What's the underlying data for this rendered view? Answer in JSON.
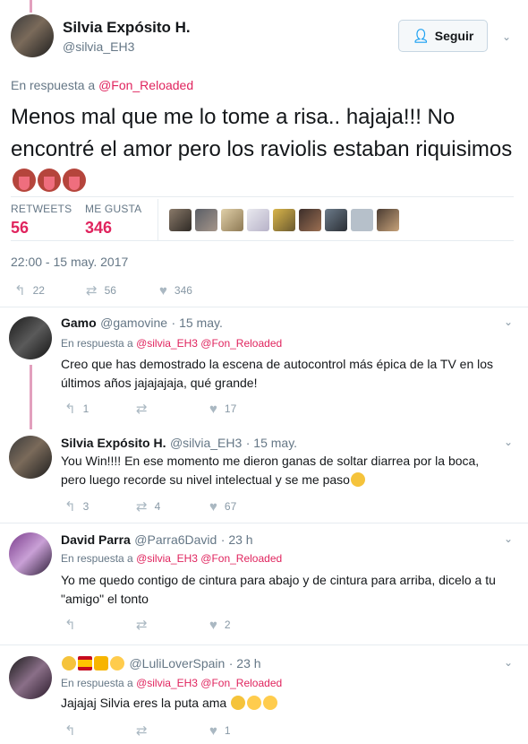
{
  "colors": {
    "accent": "#e0245e",
    "secondary": "#657786",
    "link_blue": "#1da1f2",
    "thread_line": "#e2a0bd"
  },
  "main_tweet": {
    "author_name": "Silvia Expósito H.",
    "author_handle": "@silvia_EH3",
    "follow_label": "Seguir",
    "reply_to_prefix": "En respuesta a",
    "reply_to_mention": "@Fon_Reloaded",
    "text": "Menos mal que me lo tome a risa.. hajaja!!! No encontré el amor pero los raviolis estaban riquisimos",
    "emoji_icons": [
      "tongue-emoji",
      "tongue-emoji",
      "tongue-emoji"
    ],
    "stats": {
      "retweets_label": "RETWEETS",
      "retweets_value": "56",
      "likes_label": "ME GUSTA",
      "likes_value": "346"
    },
    "liker_avatar_count": 9,
    "timestamp": "22:00 - 15 may. 2017",
    "actions": {
      "reply_count": "22",
      "retweet_count": "56",
      "like_count": "346"
    }
  },
  "replies": [
    {
      "name": "Gamo",
      "handle": "@gamovine",
      "time": "· 15 may.",
      "reply_to_prefix": "En respuesta a",
      "reply_to_mentions": "@silvia_EH3 @Fon_Reloaded",
      "text": "Creo que has demostrado la escena de autocontrol más épica de la TV en los últimos años jajajajaja, qué grande!",
      "reply_count": "1",
      "retweet_count": "",
      "like_count": "17"
    },
    {
      "name": "Silvia Expósito H.",
      "handle": "@silvia_EH3",
      "time": "· 15 may.",
      "text": "You Win!!!! En ese momento me dieron ganas de soltar diarrea por la boca, pero luego recorde su nivel intelectual y se me paso",
      "trailing_emoji": "thinking-face-emoji",
      "reply_count": "3",
      "retweet_count": "4",
      "like_count": "67"
    },
    {
      "name": "David Parra",
      "handle": "@Parra6David",
      "time": "· 23 h",
      "reply_to_prefix": "En respuesta a",
      "reply_to_mentions": "@silvia_EH3 @Fon_Reloaded",
      "text": "Yo me quedo contigo de cintura para abajo y de cintura para arriba, dicelo a tu \"amigo\" el tonto",
      "reply_count": "",
      "retweet_count": "",
      "like_count": "2"
    },
    {
      "name_emojis": [
        "princess-emoji",
        "spain-flag-emoji",
        "star-emoji",
        "yellow-heart-emoji"
      ],
      "handle": "@LuliLoverSpain",
      "time": "· 23 h",
      "reply_to_prefix": "En respuesta a",
      "reply_to_mentions": "@silvia_EH3 @Fon_Reloaded",
      "text": "Jajajaj Silvia eres la puta ama",
      "trailing_emojis": [
        "tears-of-joy-emoji",
        "clapping-hands-emoji",
        "clapping-hands-emoji"
      ],
      "reply_count": "",
      "retweet_count": "",
      "like_count": "1"
    }
  ]
}
